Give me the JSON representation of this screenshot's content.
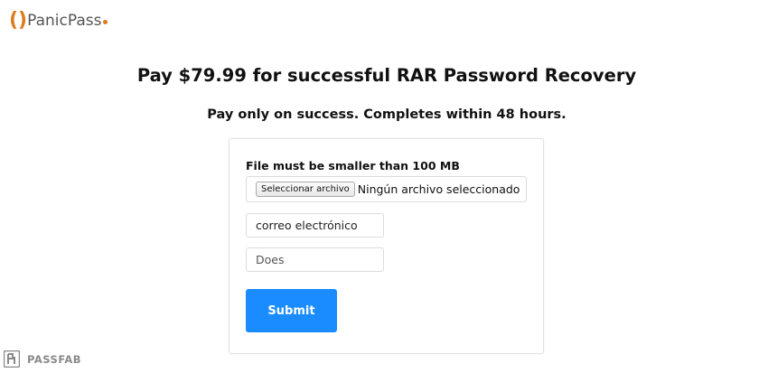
{
  "logo": {
    "paren": "()",
    "text": "PanicPass",
    "accent_color": "#e07b1d"
  },
  "header": {
    "title": "Pay $79.99 for successful RAR Password Recovery",
    "subtitle": "Pay only on success. Completes within 48 hours."
  },
  "form": {
    "file_label": "File must be smaller than 100 MB",
    "file_button": "Seleccionar archivo",
    "file_status": "Ningún archivo seleccionado",
    "email_value": "correo electrónico",
    "name_value": "Does",
    "submit_label": "Submit",
    "submit_color": "#1a8cff"
  },
  "watermark": {
    "text": "PASSFAB",
    "icon": "passfab-logo-icon"
  }
}
